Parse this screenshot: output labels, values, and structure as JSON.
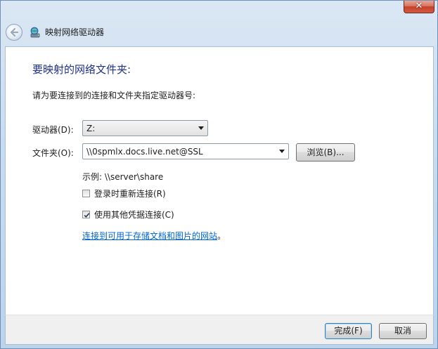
{
  "window": {
    "title": "映射网络驱动器",
    "close_glyph": "✕"
  },
  "icons": {
    "back": "back-arrow-icon",
    "title": "network-drive-icon",
    "close": "close-icon",
    "dropdown": "chevron-down-icon",
    "check": "checkmark-icon"
  },
  "main": {
    "heading": "要映射的网络文件夹:",
    "instruction": "请为要连接到的连接和文件夹指定驱动器号:",
    "drive_label": "驱动器(D):",
    "drive_value": "Z:",
    "folder_label": "文件夹(O):",
    "folder_value": "\\\\0spmlx.docs.live.net@SSL",
    "browse_label": "浏览(B)...",
    "example_text": "示例: \\\\server\\share",
    "reconnect_label": "登录时重新连接(R)",
    "reconnect_checked": false,
    "credentials_label": "使用其他凭据连接(C)",
    "credentials_checked": true,
    "link_text": "连接到可用于存储文档和图片的网站",
    "link_suffix": "。"
  },
  "footer": {
    "finish_label": "完成(F)",
    "cancel_label": "取消"
  },
  "colors": {
    "heading": "#1e3287",
    "link": "#0066cc",
    "close_button": "#c4412a"
  }
}
